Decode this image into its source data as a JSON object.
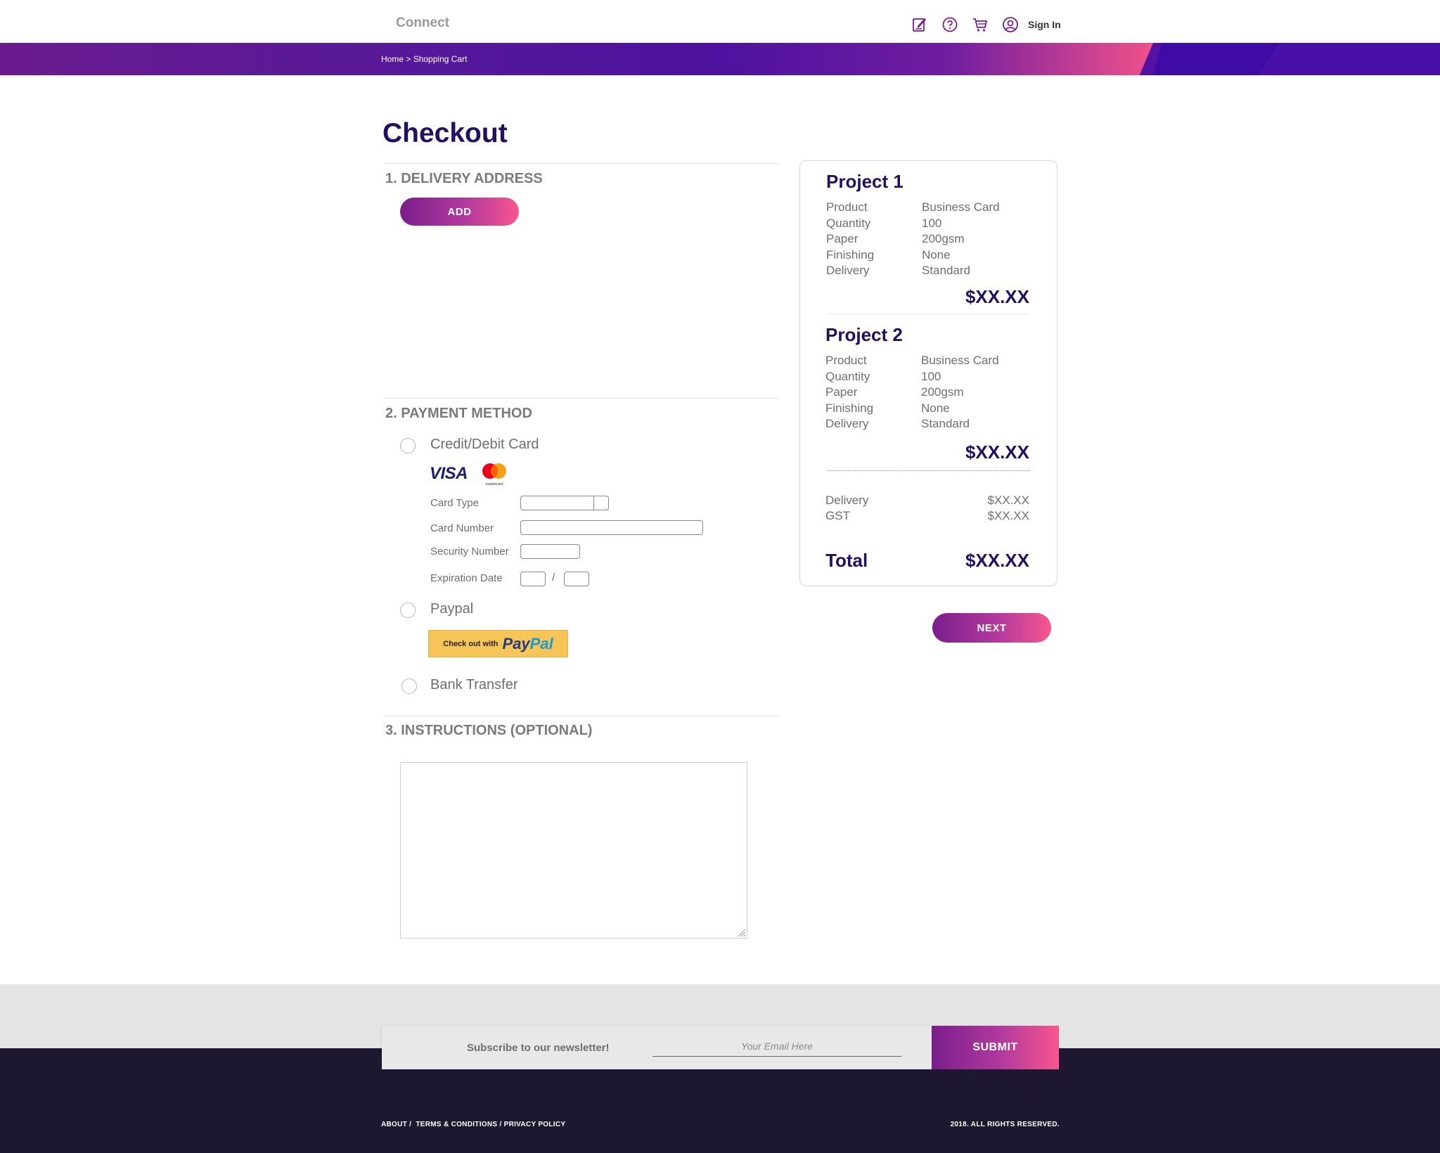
{
  "header": {
    "brand": "Connect",
    "icons": [
      "edit-icon",
      "help-icon",
      "cart-icon",
      "user-icon"
    ],
    "signin_label": "Sign In"
  },
  "breadcrumb": {
    "home": "Home",
    "separator": " > ",
    "current": "Shopping Cart"
  },
  "page": {
    "title": "Checkout"
  },
  "delivery": {
    "title": "1. DELIVERY ADDRESS",
    "add_label": "ADD"
  },
  "payment": {
    "title": "2. PAYMENT METHOD",
    "credit_label": "Credit/Debit Card",
    "visa_text": "VISA",
    "mastercard_text": "mastercard",
    "card_type_label": "Card Type",
    "card_number_label": "Card Number",
    "security_label": "Security Number",
    "expiration_label": "Expiration Date",
    "expiration_sep": "/",
    "paypal_label": "Paypal",
    "paypal_btn_small": "Check out with",
    "paypal_pay": "Pay",
    "paypal_pal": "Pal",
    "bank_label": "Bank Transfer"
  },
  "instructions": {
    "title": "3. INSTRUCTIONS (OPTIONAL)"
  },
  "summary": {
    "projects": [
      {
        "title": "Project 1",
        "rows": [
          {
            "label": "Product",
            "value": "Business Card"
          },
          {
            "label": "Quantity",
            "value": "100"
          },
          {
            "label": "Paper",
            "value": "200gsm"
          },
          {
            "label": "Finishing",
            "value": "None"
          },
          {
            "label": "Delivery",
            "value": "Standard"
          }
        ],
        "price": "$XX.XX"
      },
      {
        "title": "Project 2",
        "rows": [
          {
            "label": "Product",
            "value": "Business Card"
          },
          {
            "label": "Quantity",
            "value": "100"
          },
          {
            "label": "Paper",
            "value": "200gsm"
          },
          {
            "label": "Finishing",
            "value": "None"
          },
          {
            "label": "Delivery",
            "value": "Standard"
          }
        ],
        "price": "$XX.XX"
      }
    ],
    "delivery_label": "Delivery",
    "delivery_value": "$XX.XX",
    "gst_label": "GST",
    "gst_value": "$XX.XX",
    "total_label": "Total",
    "total_value": "$XX.XX"
  },
  "next_label": "NEXT",
  "footer": {
    "newsletter_label": "Subscribe to our newsletter!",
    "email_placeholder": "Your Email Here",
    "submit_label": "SUBMIT",
    "links": [
      "ABOUT",
      "TERMS & CONDITIONS",
      "PRIVACY POLICY"
    ],
    "copyright": "2018. ALL RIGHTS RESERVED."
  },
  "colors": {
    "primary": "#231060",
    "gradient_start": "#7a1d8c",
    "gradient_end": "#f8568e",
    "footer_dark": "#1d1730"
  }
}
